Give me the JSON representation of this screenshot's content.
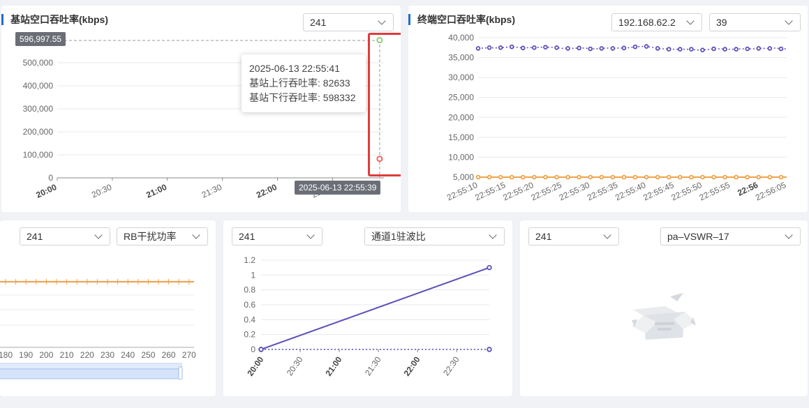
{
  "panels": {
    "bs": {
      "title": "基站空口吞吐率(kbps)",
      "select": "241",
      "tooltip": {
        "time": "2025-06-13 22:55:41",
        "up": "基站上行吞吐率: 82633",
        "down": "基站下行吞吐率: 598332"
      },
      "y_pointer_label": "596,997.55",
      "x_pointer_label": "2025-06-13 22:55:39"
    },
    "term": {
      "title": "终端空口吞吐率(kbps)",
      "select_ip": "192.168.62.2",
      "select_id": "39"
    },
    "rb": {
      "select_a": "241",
      "select_b": "RB干扰功率"
    },
    "vswr": {
      "select_a": "241",
      "select_b": "通道1驻波比"
    },
    "pa": {
      "select_a": "241",
      "select_b": "pa–VSWR–17"
    }
  },
  "chart_data": [
    {
      "type": "line",
      "x": [
        "20:00",
        "20:30",
        "21:00",
        "21:30",
        "22:00",
        "22:30",
        "22:55:41"
      ],
      "x_ticks": [
        "20:00",
        "20:30",
        "21:00",
        "21:30",
        "22:00",
        "22:30"
      ],
      "ylim": [
        0,
        600000
      ],
      "y_ticks": [
        "0",
        "100,000",
        "200,000",
        "300,000",
        "400,000",
        "500,000"
      ],
      "series": [
        {
          "name": "基站上行吞吐率",
          "color": "#ee6666",
          "points": [
            [
              "22:55:41",
              82633
            ]
          ]
        },
        {
          "name": "基站下行吞吐率",
          "color": "#91cc75",
          "points": [
            [
              "22:55:41",
              598332
            ]
          ]
        }
      ]
    },
    {
      "type": "line",
      "x": [
        "22:55:10",
        "22:55:11",
        "22:55:12",
        "22:55:13",
        "22:55:14",
        "22:55:15",
        "22:55:16",
        "22:55:17",
        "22:55:18",
        "22:55:19",
        "22:55:20",
        "22:55:21",
        "22:55:22",
        "22:55:23",
        "22:55:24",
        "22:55:25",
        "22:55:26",
        "22:55:27",
        "22:55:28",
        "22:55:29",
        "22:55:30",
        "22:55:31",
        "22:55:32",
        "22:55:33",
        "22:55:34",
        "22:55:35",
        "22:55:36",
        "22:55:37",
        "22:55:38",
        "22:55:39",
        "22:55:40",
        "22:55:41",
        "22:55:42",
        "22:55:43",
        "22:55:44",
        "22:55:45",
        "22:55:46",
        "22:55:47",
        "22:55:48",
        "22:55:49",
        "22:55:50",
        "22:55:51",
        "22:55:52",
        "22:55:53",
        "22:55:54",
        "22:55:55",
        "22:55:56",
        "22:55:57",
        "22:55:58",
        "22:55:59",
        "22:56:00",
        "22:56:01",
        "22:56:02",
        "22:56:03",
        "22:56:04",
        "22:56:05"
      ],
      "x_ticks": [
        "22:55:10",
        "22:55:15",
        "22:55:20",
        "22:55:25",
        "22:55:30",
        "22:55:35",
        "22:55:40",
        "22:55:45",
        "22:55:50",
        "22:55:55",
        "22:56",
        "22:56:05"
      ],
      "ylim": [
        5000,
        40000
      ],
      "y_ticks": [
        "5,000",
        "10,000",
        "15,000",
        "20,000",
        "25,000",
        "30,000",
        "35,000",
        "40,000"
      ],
      "series": [
        {
          "color": "#5b4fb8",
          "values": [
            37300,
            37400,
            37500,
            37400,
            37500,
            37600,
            37700,
            37600,
            37400,
            37500,
            37500,
            37600,
            37600,
            37600,
            37500,
            37300,
            37300,
            37300,
            37400,
            37400,
            37200,
            37200,
            37300,
            37400,
            37300,
            37400,
            37400,
            37500,
            37700,
            37800,
            37800,
            37600,
            37300,
            37200,
            37100,
            37100,
            37100,
            37100,
            37100,
            36900,
            36900,
            37000,
            37200,
            37200,
            37100,
            37100,
            37100,
            37200,
            37200,
            37200,
            37300,
            37300,
            37300,
            37400,
            37200,
            37200
          ]
        },
        {
          "color": "#f0a24a",
          "values": [
            5000,
            5000,
            5000,
            5000,
            5000,
            5000,
            5000,
            5000,
            5000,
            5000,
            5000,
            5000,
            5000,
            5000,
            5000,
            5000,
            5000,
            5000,
            5000,
            5000,
            5000,
            5000,
            5000,
            5000,
            5000,
            5000,
            5000,
            5000,
            5000,
            5000,
            5000,
            5000,
            5000,
            5000,
            5000,
            5000,
            5000,
            5000,
            5000,
            5000,
            5000,
            5000,
            5000,
            5000,
            5000,
            5000,
            5000,
            5000,
            5000,
            5000,
            5000,
            5000,
            5000,
            5000,
            5000,
            5000
          ]
        }
      ]
    },
    {
      "type": "line",
      "x_ticks": [
        "180",
        "190",
        "200",
        "210",
        "220",
        "230",
        "240",
        "250",
        "260",
        "270"
      ],
      "series": [
        {
          "color": "#f0a24a",
          "values": "flat"
        }
      ]
    },
    {
      "type": "line",
      "x_ticks": [
        "20:00",
        "20:30",
        "21:00",
        "21:30",
        "22:00",
        "22:30"
      ],
      "ylim": [
        0,
        1.2
      ],
      "y_ticks": [
        "0",
        "0.2",
        "0.4",
        "0.6",
        "0.8",
        "1",
        "1.2"
      ],
      "series": [
        {
          "color": "#5b4fb8",
          "points": [
            [
              "20:00",
              0
            ],
            [
              "22:55",
              1.1
            ]
          ]
        },
        {
          "color": "#5b4fb8",
          "points": [
            [
              "20:00",
              0
            ],
            [
              "22:55",
              0
            ]
          ]
        }
      ]
    }
  ]
}
